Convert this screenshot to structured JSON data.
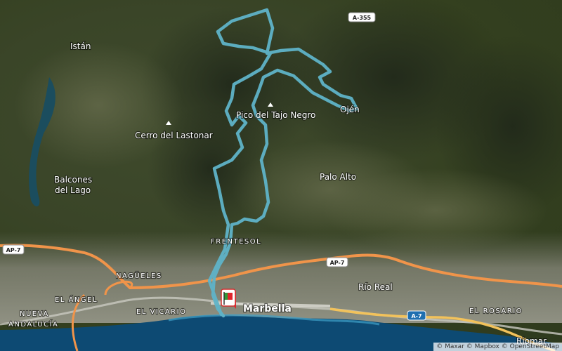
{
  "map": {
    "labels": {
      "istan": "Istán",
      "cerro_lastonar": "Cerro del Lastonar",
      "pico_tajo_negro": "Pico del Tajo Negro",
      "ojen": "Ojén",
      "balcones_line1": "Balcones",
      "balcones_line2": "del Lago",
      "palo_alto": "Palo Alto",
      "fuente_sol": "FRENTESOL",
      "nagueles": "NAGÜELES",
      "el_angel": "EL ÁNGEL",
      "el_vicario": "EL VICARIO",
      "nueva_line1": "NUEVA",
      "nueva_line2": "ANDALUCÍA",
      "marbella": "Marbella",
      "rio_real": "Río Real",
      "el_rosario": "EL ROSARIO",
      "riomar": "Riomar"
    },
    "road_shields": {
      "a355": "A-355",
      "ap7_left": "AP-7",
      "ap7_center": "AP-7",
      "a7": "A-7"
    },
    "attribution": "© Maxar © Mapbox © OpenStreetMap",
    "colors": {
      "route": "#5fb3c8",
      "motorway": "#f0944a",
      "highway": "#f2c25b",
      "sea": "#0d4a73",
      "start_flag": "#2e9b3a",
      "end_pin": "#e0242c"
    }
  }
}
